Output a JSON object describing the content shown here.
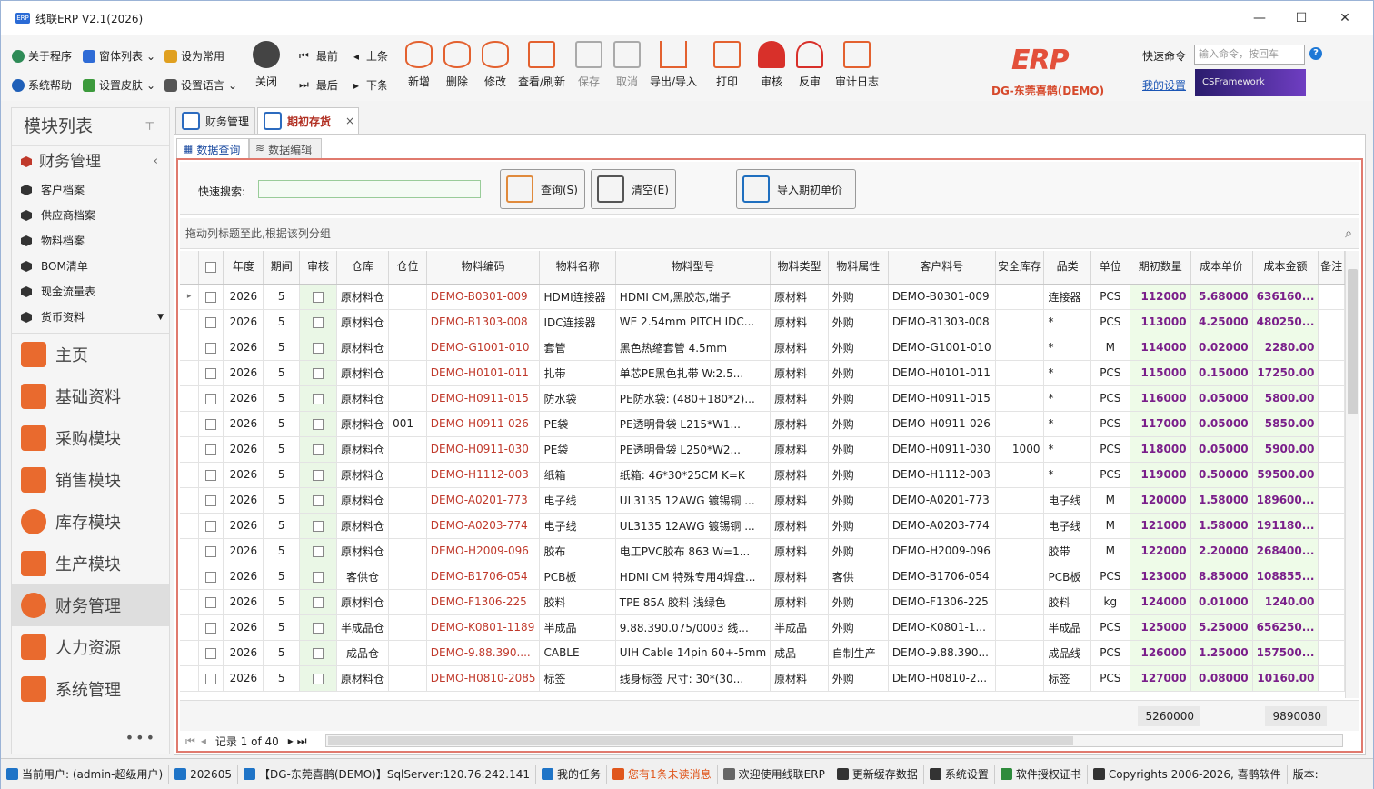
{
  "app": {
    "title": "线联ERP V2.1(2026)",
    "logo_text": "ERP"
  },
  "window": {
    "min": "—",
    "max": "☐",
    "close": "✕"
  },
  "ribbon": {
    "small": [
      {
        "label": "关于程序",
        "color": "#2e8b57"
      },
      {
        "label": "窗体列表",
        "color": "#2e6bd6"
      },
      {
        "label": "设为常用",
        "color": "#e0a020"
      },
      {
        "label": "系统帮助",
        "color": "#1e5fb8"
      },
      {
        "label": "设置皮肤",
        "color": "#3c9a3c"
      },
      {
        "label": "设置语言",
        "color": "#555555"
      }
    ],
    "close": "关闭",
    "nav": {
      "first": "最前",
      "prev": "上条",
      "last": "最后",
      "next": "下条"
    },
    "buttons": [
      "新增",
      "删除",
      "修改",
      "查看/刷新",
      "保存",
      "取消",
      "导出/导入",
      "打印",
      "审核",
      "反审",
      "审计日志"
    ],
    "brand_sub": "DG-东莞喜鹊(DEMO)",
    "cmd_label": "快速命令",
    "cmd_placeholder": "输入命令，按回车",
    "my_settings": "我的设置",
    "csfw": "CSFramework",
    "erp_logo": "ERP"
  },
  "sidebar": {
    "title": "模块列表",
    "group": "财务管理",
    "subitems": [
      "客户档案",
      "供应商档案",
      "物料档案",
      "BOM清单",
      "现金流量表",
      "货币资料"
    ],
    "modules": [
      {
        "label": "主页",
        "color": "#e96a2e"
      },
      {
        "label": "基础资料",
        "color": "#e96a2e"
      },
      {
        "label": "采购模块",
        "color": "#e96a2e"
      },
      {
        "label": "销售模块",
        "color": "#e96a2e"
      },
      {
        "label": "库存模块",
        "color": "#e96a2e"
      },
      {
        "label": "生产模块",
        "color": "#e96a2e"
      },
      {
        "label": "财务管理",
        "color": "#e96a2e"
      },
      {
        "label": "人力资源",
        "color": "#e96a2e"
      },
      {
        "label": "系统管理",
        "color": "#e96a2e"
      }
    ],
    "active_module": "财务管理"
  },
  "tabs": {
    "tab1": "财务管理",
    "tab2": "期初存货"
  },
  "subtabs": {
    "query": "数据查询",
    "edit": "数据编辑"
  },
  "search": {
    "label": "快速搜索:",
    "query_btn": "查询(S)",
    "clear_btn": "清空(E)",
    "import_btn": "导入期初单价"
  },
  "grid": {
    "group_hint": "拖动列标题至此,根据该列分组",
    "columns": [
      "年度",
      "期间",
      "审核",
      "仓库",
      "仓位",
      "物料编码",
      "物料名称",
      "物料型号",
      "物料类型",
      "物料属性",
      "客户料号",
      "安全库存",
      "品类",
      "单位",
      "期初数量",
      "成本单价",
      "成本金额",
      "备注"
    ],
    "rows": [
      [
        "2026",
        "5",
        "原材料仓",
        "",
        "DEMO-B0301-009",
        "HDMI连接器",
        "HDMI CM,黑胶芯,端子",
        "原材料",
        "外购",
        "DEMO-B0301-009",
        "",
        "连接器",
        "PCS",
        "112000",
        "5.68000",
        "636160..."
      ],
      [
        "2026",
        "5",
        "原材料仓",
        "",
        "DEMO-B1303-008",
        "IDC连接器",
        "WE 2.54mm PITCH IDC...",
        "原材料",
        "外购",
        "DEMO-B1303-008",
        "",
        "*",
        "PCS",
        "113000",
        "4.25000",
        "480250..."
      ],
      [
        "2026",
        "5",
        "原材料仓",
        "",
        "DEMO-G1001-010",
        "套管",
        "黑色热缩套管 4.5mm",
        "原材料",
        "外购",
        "DEMO-G1001-010",
        "",
        "*",
        "M",
        "114000",
        "0.02000",
        "2280.00"
      ],
      [
        "2026",
        "5",
        "原材料仓",
        "",
        "DEMO-H0101-011",
        "扎带",
        "单芯PE黑色扎带 W:2.5...",
        "原材料",
        "外购",
        "DEMO-H0101-011",
        "",
        "*",
        "PCS",
        "115000",
        "0.15000",
        "17250.00"
      ],
      [
        "2026",
        "5",
        "原材料仓",
        "",
        "DEMO-H0911-015",
        "防水袋",
        "PE防水袋: (480+180*2)...",
        "原材料",
        "外购",
        "DEMO-H0911-015",
        "",
        "*",
        "PCS",
        "116000",
        "0.05000",
        "5800.00"
      ],
      [
        "2026",
        "5",
        "原材料仓",
        "001",
        "DEMO-H0911-026",
        "PE袋",
        "PE透明骨袋 L215*W1...",
        "原材料",
        "外购",
        "DEMO-H0911-026",
        "",
        "*",
        "PCS",
        "117000",
        "0.05000",
        "5850.00"
      ],
      [
        "2026",
        "5",
        "原材料仓",
        "",
        "DEMO-H0911-030",
        "PE袋",
        "PE透明骨袋 L250*W2...",
        "原材料",
        "外购",
        "DEMO-H0911-030",
        "1000",
        "*",
        "PCS",
        "118000",
        "0.05000",
        "5900.00"
      ],
      [
        "2026",
        "5",
        "原材料仓",
        "",
        "DEMO-H1112-003",
        "纸箱",
        "纸箱: 46*30*25CM K=K",
        "原材料",
        "外购",
        "DEMO-H1112-003",
        "",
        "*",
        "PCS",
        "119000",
        "0.50000",
        "59500.00"
      ],
      [
        "2026",
        "5",
        "原材料仓",
        "",
        "DEMO-A0201-773",
        "电子线",
        "UL3135 12AWG 镀锡铜 ...",
        "原材料",
        "外购",
        "DEMO-A0201-773",
        "",
        "电子线",
        "M",
        "120000",
        "1.58000",
        "189600..."
      ],
      [
        "2026",
        "5",
        "原材料仓",
        "",
        "DEMO-A0203-774",
        "电子线",
        "UL3135 12AWG 镀锡铜 ...",
        "原材料",
        "外购",
        "DEMO-A0203-774",
        "",
        "电子线",
        "M",
        "121000",
        "1.58000",
        "191180..."
      ],
      [
        "2026",
        "5",
        "原材料仓",
        "",
        "DEMO-H2009-096",
        "胶布",
        "电工PVC胶布 863 W=1...",
        "原材料",
        "外购",
        "DEMO-H2009-096",
        "",
        "胶带",
        "M",
        "122000",
        "2.20000",
        "268400..."
      ],
      [
        "2026",
        "5",
        "客供仓",
        "",
        "DEMO-B1706-054",
        "PCB板",
        "HDMI CM 特殊专用4焊盘...",
        "原材料",
        "客供",
        "DEMO-B1706-054",
        "",
        "PCB板",
        "PCS",
        "123000",
        "8.85000",
        "108855..."
      ],
      [
        "2026",
        "5",
        "原材料仓",
        "",
        "DEMO-F1306-225",
        "胶料",
        "TPE 85A 胶料 浅绿色",
        "原材料",
        "外购",
        "DEMO-F1306-225",
        "",
        "胶料",
        "kg",
        "124000",
        "0.01000",
        "1240.00"
      ],
      [
        "2026",
        "5",
        "半成品仓",
        "",
        "DEMO-K0801-1189",
        "半成品",
        "9.88.390.075/0003 线...",
        "半成品",
        "外购",
        "DEMO-K0801-1...",
        "",
        "半成品",
        "PCS",
        "125000",
        "5.25000",
        "656250..."
      ],
      [
        "2026",
        "5",
        "成品仓",
        "",
        "DEMO-9.88.390....",
        "CABLE",
        "UIH Cable 14pin 60+-5mm",
        "成品",
        "自制生产",
        "DEMO-9.88.390...",
        "",
        "成品线",
        "PCS",
        "126000",
        "1.25000",
        "157500..."
      ],
      [
        "2026",
        "5",
        "原材料仓",
        "",
        "DEMO-H0810-2085",
        "标签",
        "线身标签 尺寸: 30*(30...",
        "原材料",
        "外购",
        "DEMO-H0810-2...",
        "",
        "标签",
        "PCS",
        "127000",
        "0.08000",
        "10160.00"
      ]
    ],
    "sum_qty": "5260000",
    "sum_amount": "9890080"
  },
  "pager": {
    "record": "记录 1 of 40"
  },
  "status": [
    "当前用户: (admin-超级用户)",
    "202605",
    "【DG-东莞喜鹊(DEMO)】SqlServer:120.76.242.141",
    "我的任务",
    "您有1条未读消息",
    "欢迎使用线联ERP",
    "更新缓存数据",
    "系统设置",
    "软件授权证书",
    "Copyrights 2006-2026, 喜鹊软件",
    "版本:"
  ]
}
